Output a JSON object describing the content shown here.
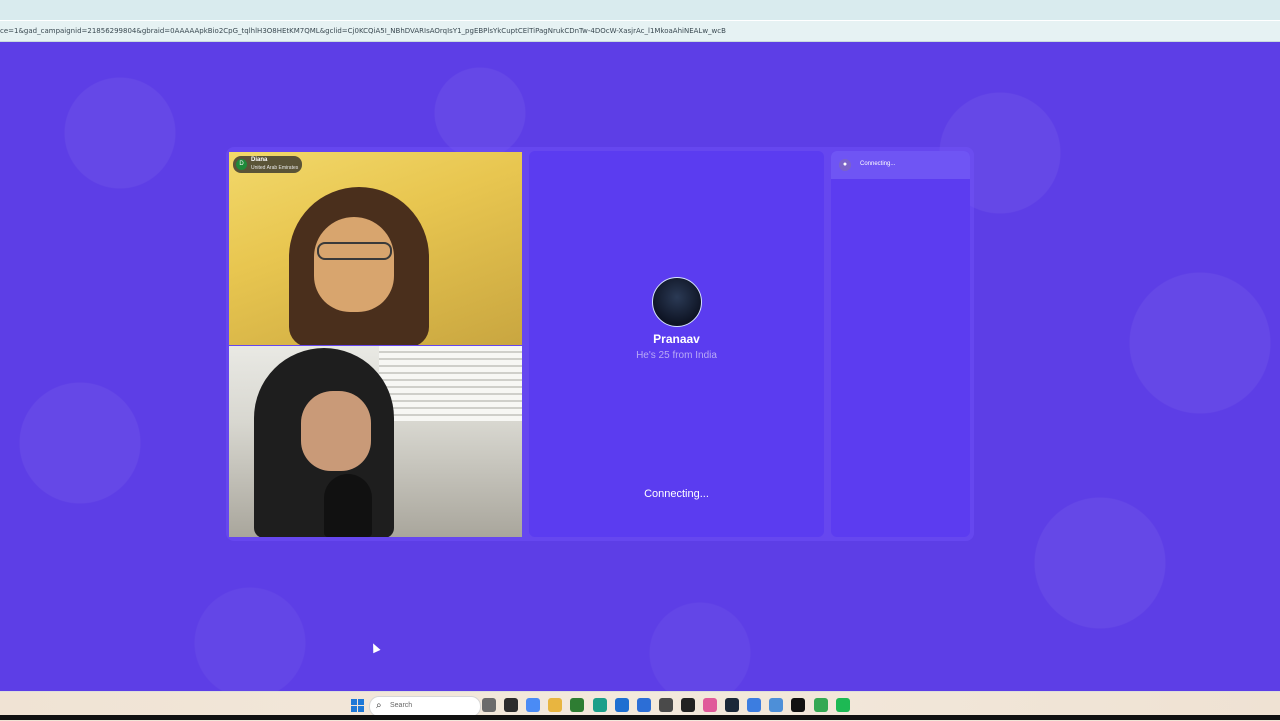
{
  "browser": {
    "url": "ce=1&gad_campaignid=21856299804&gbraid=0AAAAApkBio2CpG_tqlhlH3O8HEtKM7QML&gclid=Cj0KCQiA5I_NBhDVARIsAOrqIsY1_pgEBPlsYkCuptCElTiPagNrukCDnTw-4DOcW-XasjrAc_l1MkoaAhiNEALw_wcB"
  },
  "self_tag": {
    "initial": "D",
    "name": "Diana",
    "country": "United Arab Emirates"
  },
  "partner": {
    "name": "Pranaav",
    "info": "He's 25 from India",
    "status": "Connecting..."
  },
  "side_panel": {
    "status": "Connecting..."
  },
  "taskbar": {
    "search_placeholder": "Search",
    "apps": [
      {
        "icon": "widgets-icon",
        "color": "#6b6b6b"
      },
      {
        "icon": "file-explorer-icon",
        "color": "#2c2c2c"
      },
      {
        "icon": "chrome-icon",
        "color": "#4a8bf5"
      },
      {
        "icon": "folder-icon",
        "color": "#e8b540"
      },
      {
        "icon": "nvidia-icon",
        "color": "#2e7d32"
      },
      {
        "icon": "edge-icon",
        "color": "#1b9f8a"
      },
      {
        "icon": "store-icon",
        "color": "#1e6fd1"
      },
      {
        "icon": "mail-icon",
        "color": "#2c6ed6"
      },
      {
        "icon": "vpn-icon",
        "color": "#4a4a4a"
      },
      {
        "icon": "terminal-icon",
        "color": "#222222"
      },
      {
        "icon": "discord-icon",
        "color": "#e05a9a"
      },
      {
        "icon": "steam-icon",
        "color": "#1b2838"
      },
      {
        "icon": "browser-icon",
        "color": "#3c7de0"
      },
      {
        "icon": "notes-icon",
        "color": "#4d8fd8"
      },
      {
        "icon": "app-m-icon",
        "color": "#111111"
      },
      {
        "icon": "chrome-alt-icon",
        "color": "#34a853"
      },
      {
        "icon": "spotify-icon",
        "color": "#1db954"
      }
    ]
  }
}
